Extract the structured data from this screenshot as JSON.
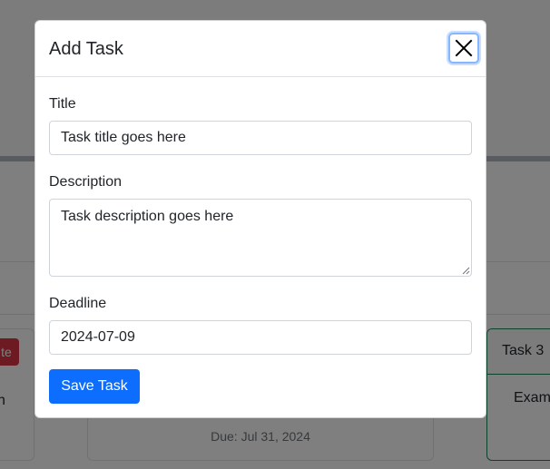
{
  "background": {
    "left_card": {
      "button_label": "te",
      "text": "h"
    },
    "middle_card": {
      "due": "Due: Jul 31, 2024"
    },
    "right_card": {
      "title": "Task 3",
      "body": "Exam"
    }
  },
  "modal": {
    "title": "Add Task",
    "close_icon": "close-x-icon",
    "fields": {
      "title": {
        "label": "Title",
        "value": "Task title goes here"
      },
      "description": {
        "label": "Description",
        "value": "Task description goes here"
      },
      "deadline": {
        "label": "Deadline",
        "value": "2024-07-09"
      }
    },
    "save_label": "Save Task"
  },
  "colors": {
    "primary": "#0d6efd",
    "danger": "#dc3545",
    "success": "#198754",
    "focus_ring": "#86b7fe"
  }
}
